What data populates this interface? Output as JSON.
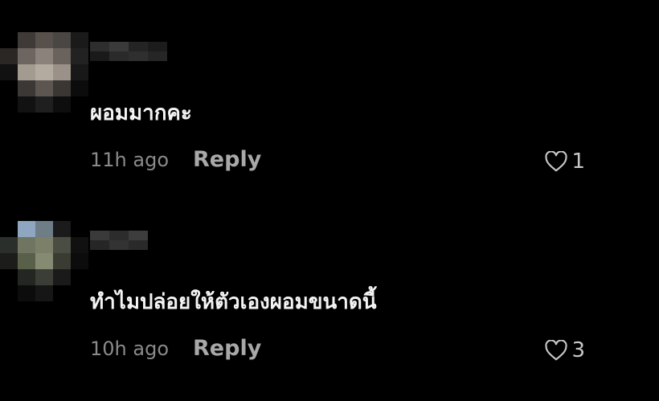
{
  "comments": [
    {
      "text": "ผอมมากคะ",
      "time": "11h ago",
      "reply_label": "Reply",
      "likes": "1",
      "like_icon": "heart-outline-icon"
    },
    {
      "text": "ทำไมปล่อยให้ตัวเองผอมขนาดนี้",
      "time": "10h ago",
      "reply_label": "Reply",
      "likes": "3",
      "like_icon": "heart-outline-icon"
    }
  ],
  "colors": {
    "background": "#000000",
    "text": "#f4f4f4",
    "muted": "#8a8a8a",
    "reply": "#a8a8a8"
  }
}
